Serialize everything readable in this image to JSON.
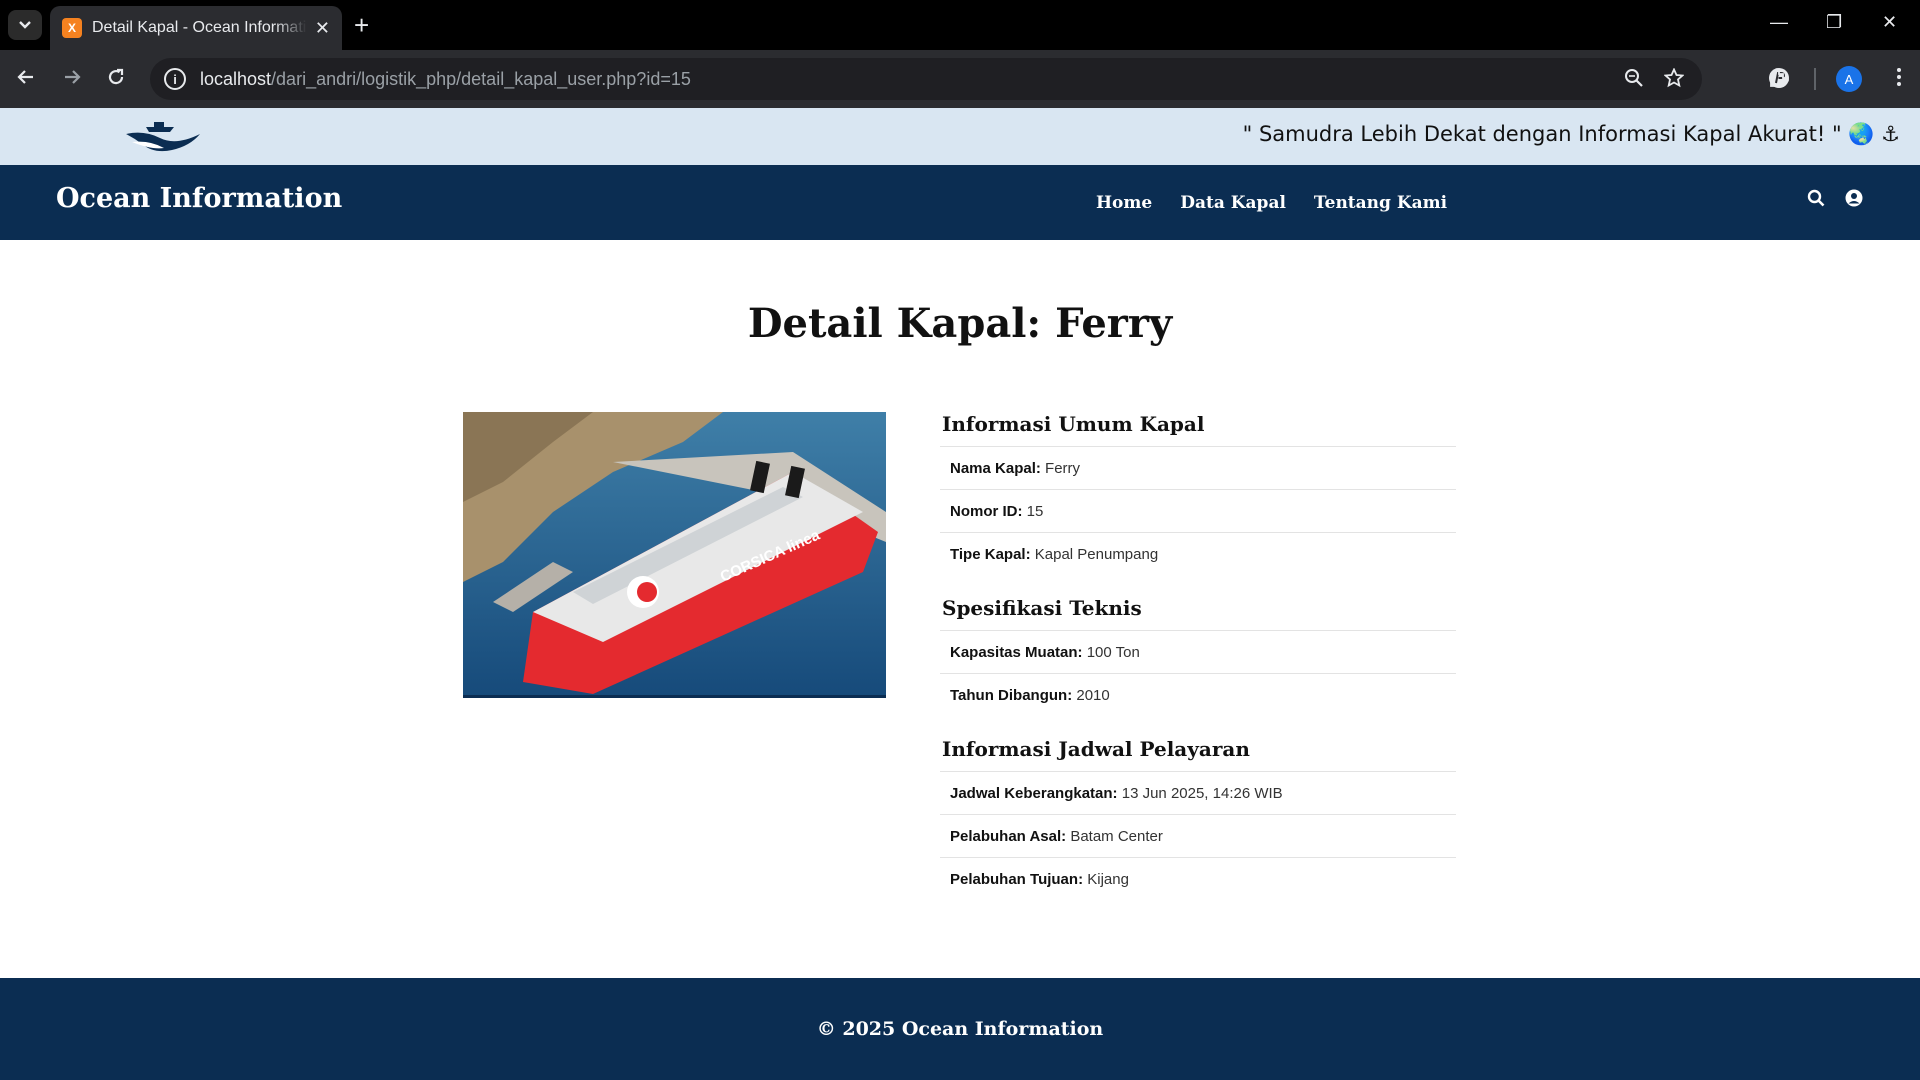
{
  "browser": {
    "tab_title": "Detail Kapal - Ocean Information",
    "url_host": "localhost",
    "url_path": "/dari_andri/logistik_php/detail_kapal_user.php?id=15",
    "profile_initial": "A",
    "favicon_letter": "X"
  },
  "topbar": {
    "tagline": "\" Samudra Lebih Dekat dengan Informasi Kapal Akurat! \" 🌏 ⚓"
  },
  "navbar": {
    "brand": "Ocean Information",
    "menu": [
      "Home",
      "Data Kapal",
      "Tentang Kami"
    ],
    "icons": [
      "search-icon",
      "user-icon"
    ]
  },
  "page": {
    "title": "Detail Kapal: Ferry",
    "image_caption": "CORSICA linea"
  },
  "sections": [
    {
      "title": "Informasi Umum Kapal",
      "rows": [
        {
          "label": "Nama Kapal:",
          "value": "Ferry"
        },
        {
          "label": "Nomor ID:",
          "value": "15"
        },
        {
          "label": "Tipe Kapal:",
          "value": "Kapal Penumpang"
        }
      ]
    },
    {
      "title": "Spesifikasi Teknis",
      "rows": [
        {
          "label": "Kapasitas Muatan:",
          "value": "100 Ton"
        },
        {
          "label": "Tahun Dibangun:",
          "value": "2010"
        }
      ]
    },
    {
      "title": "Informasi Jadwal Pelayaran",
      "rows": [
        {
          "label": "Jadwal Keberangkatan:",
          "value": "13 Jun 2025, 14:26 WIB"
        },
        {
          "label": "Pelabuhan Asal:",
          "value": "Batam Center"
        },
        {
          "label": "Pelabuhan Tujuan:",
          "value": "Kijang"
        }
      ]
    }
  ],
  "footer": {
    "text": "© 2025 Ocean Information"
  },
  "colors": {
    "navy": "#0b2d52",
    "topbar": "#d9e6f2",
    "ship_red": "#e42a2f"
  }
}
